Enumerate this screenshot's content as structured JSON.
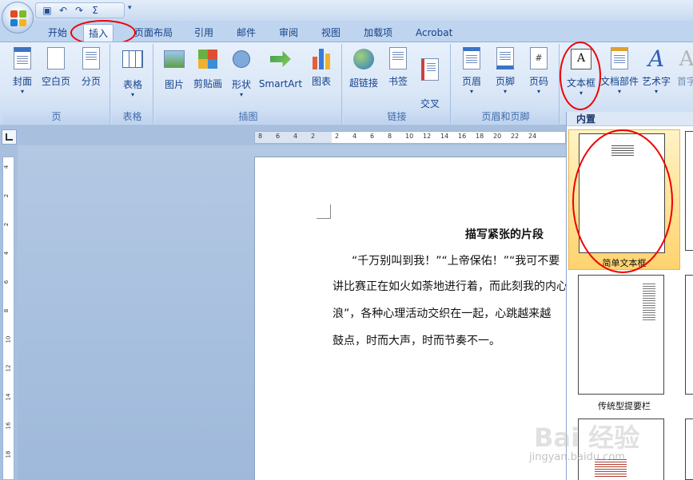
{
  "quick_access": {
    "save_icon": "save-icon",
    "undo_icon": "undo-icon",
    "redo_icon": "redo-icon",
    "sum_icon": "sum-icon"
  },
  "tabs": [
    "开始",
    "插入",
    "页面布局",
    "引用",
    "邮件",
    "审阅",
    "视图",
    "加载项",
    "Acrobat"
  ],
  "active_tab": "插入",
  "ribbon": {
    "groups": [
      {
        "label": "页",
        "buttons": [
          "封面",
          "空白页",
          "分页"
        ]
      },
      {
        "label": "表格",
        "buttons": [
          "表格"
        ]
      },
      {
        "label": "插图",
        "buttons": [
          "图片",
          "剪贴画",
          "形状",
          "SmartArt",
          "图表"
        ]
      },
      {
        "label": "链接",
        "buttons": [
          "超链接",
          "书签",
          "交叉\n引用"
        ]
      },
      {
        "label": "页眉和页脚",
        "buttons": [
          "页眉",
          "页脚",
          "页码"
        ]
      },
      {
        "label": "",
        "buttons": [
          "文本框",
          "文档部件",
          "艺术字",
          "首字"
        ]
      }
    ]
  },
  "ruler": {
    "ticks": [
      "8",
      "6",
      "4",
      "2",
      "2",
      "4",
      "6",
      "8",
      "10",
      "12",
      "14",
      "16",
      "18",
      "20",
      "22",
      "24"
    ],
    "vticks": [
      "4",
      "2",
      "2",
      "4",
      "6",
      "8",
      "10",
      "12",
      "14",
      "16",
      "18"
    ]
  },
  "document": {
    "title": "描写紧张的片段",
    "lines": [
      "“千万别叫到我！”“上帝保佑！”“我可不要",
      "讲比赛正在如火如荼地进行着，而此刻我的内心",
      "浪”，各种心理活动交织在一起，心跳越来越",
      "鼓点，时而大声，时而节奏不一。"
    ]
  },
  "gallery": {
    "header": "内置",
    "items": [
      "简单文本框",
      "传统型提要栏"
    ]
  },
  "watermark": {
    "text": "Bai",
    "text2": "经验",
    "url": "jingyan.baidu.com"
  },
  "colors": {
    "annotation": "#e00000",
    "selected_tile": "#ffd36e",
    "ribbon_text": "#15428b"
  }
}
